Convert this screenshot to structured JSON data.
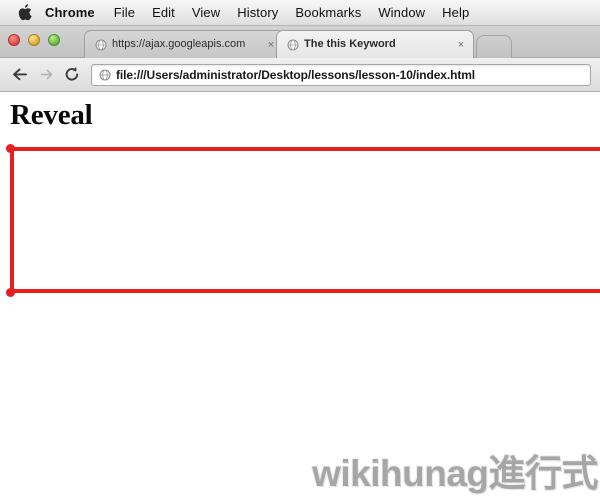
{
  "menubar": {
    "apple_icon": "apple-logo-icon",
    "items": [
      {
        "label": "Chrome",
        "active": true
      },
      {
        "label": "File",
        "active": false
      },
      {
        "label": "Edit",
        "active": false
      },
      {
        "label": "View",
        "active": false
      },
      {
        "label": "History",
        "active": false
      },
      {
        "label": "Bookmarks",
        "active": false
      },
      {
        "label": "Window",
        "active": false
      },
      {
        "label": "Help",
        "active": false
      }
    ]
  },
  "window_controls": {
    "close_label": "close-button",
    "minimize_label": "minimize-button",
    "maximize_label": "maximize-button"
  },
  "tabs": [
    {
      "title": "https://ajax.googleapis.com",
      "favicon": "globe-icon",
      "close_glyph": "×",
      "active": false
    },
    {
      "title": "The this Keyword",
      "favicon": "globe-icon",
      "close_glyph": "×",
      "active": true
    }
  ],
  "newtab_button": {
    "name": "new-tab-button"
  },
  "toolbar": {
    "back_glyph": "←",
    "forward_glyph": "→",
    "reload_glyph": "⟳",
    "back_enabled": true,
    "forward_enabled": false,
    "omnibox": {
      "icon": "globe-icon",
      "value": "file:///Users/administrator/Desktop/lessons/lesson-10/index.html",
      "placeholder": "Search Google or type URL"
    }
  },
  "page": {
    "heading": "Reveal",
    "reveal_box": {
      "border_color": "#e81f1f",
      "border_width_px": 4
    },
    "watermark": "wikihunag進行式"
  },
  "colors": {
    "accent_red": "#e81f1f",
    "menubar_text": "#111111",
    "watermark_gray": "#a6a6a6"
  }
}
